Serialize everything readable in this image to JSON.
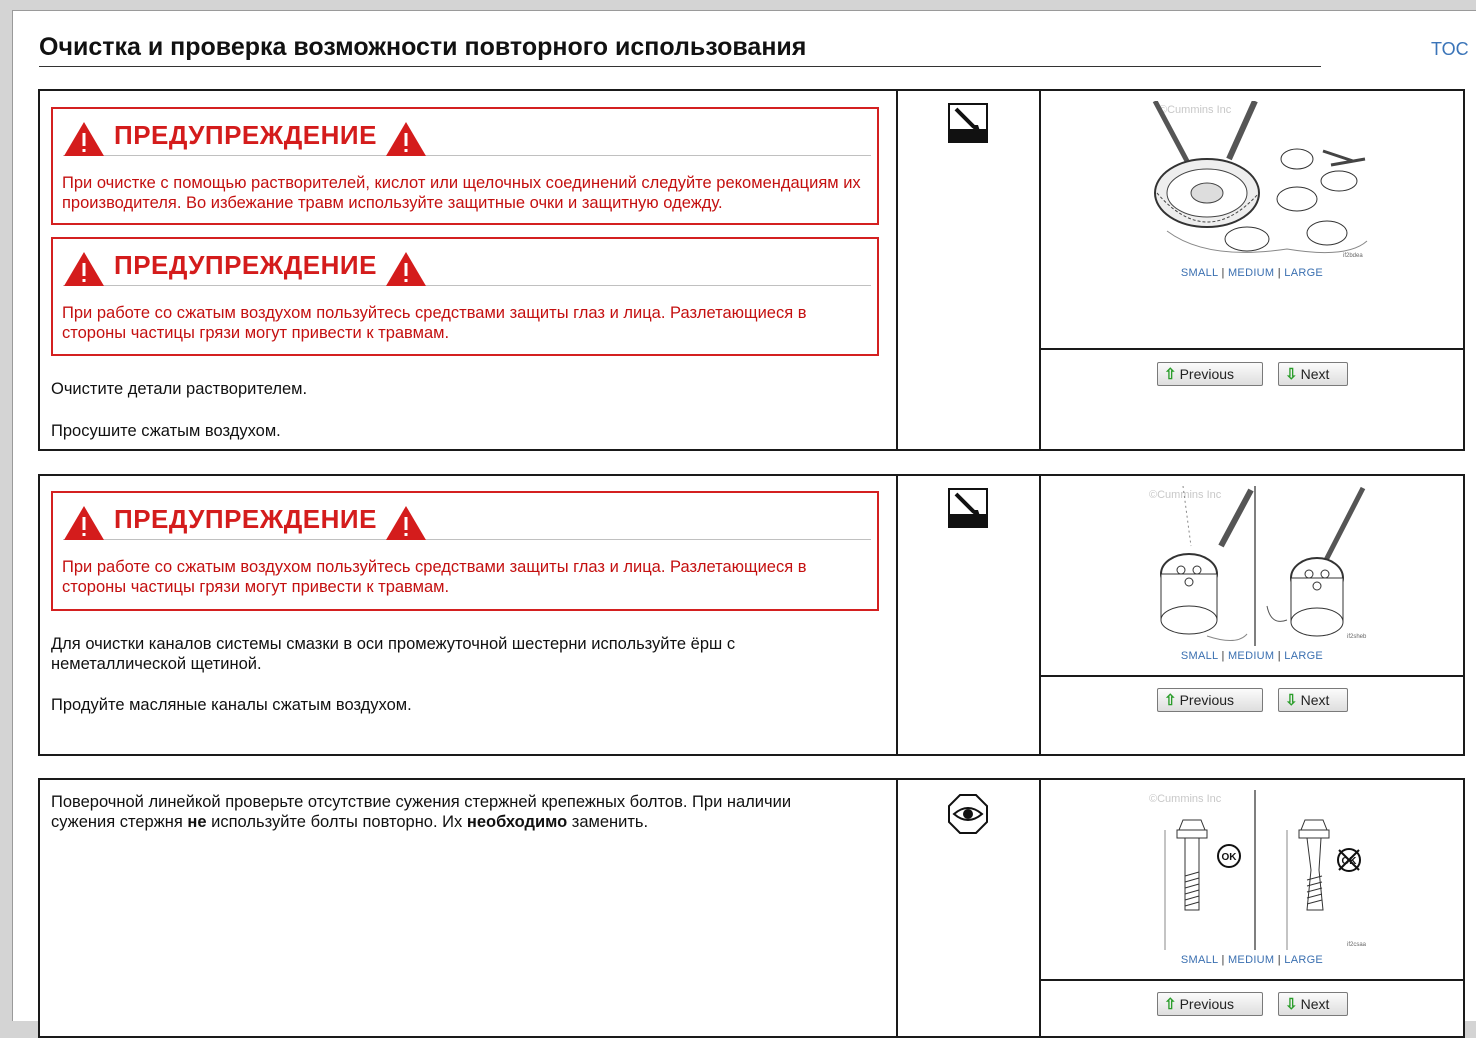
{
  "page": {
    "title": "Очистка и проверка возможности повторного использования",
    "toc_label": "TOC"
  },
  "steps": [
    {
      "warnings": [
        {
          "title": "ПРЕДУПРЕЖДЕНИЕ",
          "text": "При очистке с помощью растворителей, кислот или щелочных соединений следуйте рекомендациям их производителя. Во избежание травм используйте защитные очки и защитную одежду."
        },
        {
          "title": "ПРЕДУПРЕЖДЕНИЕ",
          "text": "При работе со сжатым воздухом пользуйтесь средствами защиты глаз и лица. Разлетающиеся в стороны частицы грязи могут привести к травмам."
        }
      ],
      "paragraphs": [
        "Очистите детали растворителем.",
        "Просушите сжатым воздухом."
      ],
      "icon": "cleaning-icon",
      "figure": {
        "watermark": "©Cummins Inc",
        "code": "if2bdea"
      },
      "size_links": {
        "small": "SMALL",
        "medium": "MEDIUM",
        "large": "LARGE",
        "sep": "|"
      },
      "nav": {
        "previous": "Previous",
        "next": "Next"
      }
    },
    {
      "warnings": [
        {
          "title": "ПРЕДУПРЕЖДЕНИЕ",
          "text": "При работе со сжатым воздухом пользуйтесь средствами защиты глаз и лица. Разлетающиеся в стороны частицы грязи могут привести к травмам."
        }
      ],
      "paragraphs": [
        "Для очистки каналов системы смазки в оси промежуточной шестерни используйте ёрш с неметаллической щетиной.",
        "Продуйте масляные каналы сжатым воздухом."
      ],
      "icon": "cleaning-icon",
      "figure": {
        "watermark": "©Cummins Inc",
        "code": "if2sheb"
      },
      "size_links": {
        "small": "SMALL",
        "medium": "MEDIUM",
        "large": "LARGE",
        "sep": "|"
      },
      "nav": {
        "previous": "Previous",
        "next": "Next"
      }
    },
    {
      "text_parts": {
        "p1": "Поверочной линейкой проверьте отсутствие сужения стержней крепежных болтов. При наличии сужения стержня ",
        "b1": "не",
        "p2": " используйте болты повторно. Их ",
        "b2": "необходимо",
        "p3": " заменить."
      },
      "icon": "eye-inspect-icon",
      "figure": {
        "watermark": "©Cummins Inc",
        "code": "if2csaa",
        "ok_label": "OK"
      },
      "size_links": {
        "small": "SMALL",
        "medium": "MEDIUM",
        "large": "LARGE",
        "sep": "|"
      },
      "nav": {
        "previous": "Previous",
        "next": "Next"
      }
    }
  ]
}
